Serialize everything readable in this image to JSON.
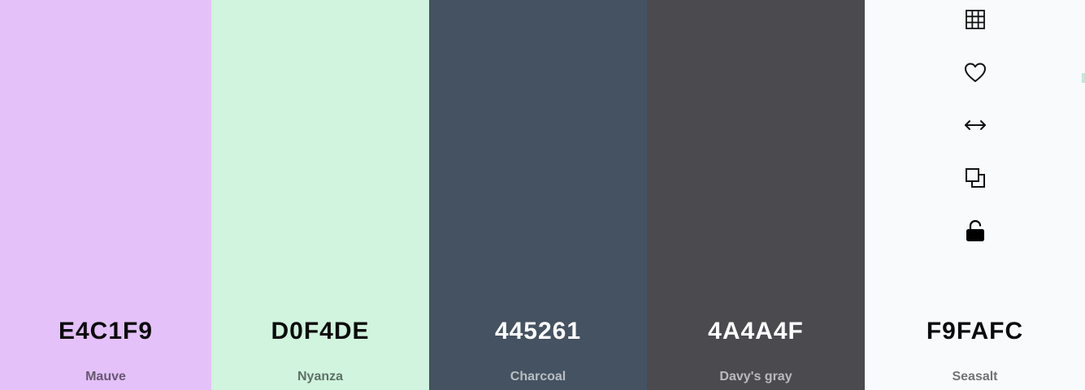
{
  "palette": {
    "swatches": [
      {
        "hex": "E4C1F9",
        "name": "Mauve",
        "color": "#E4C1F9"
      },
      {
        "hex": "D0F4DE",
        "name": "Nyanza",
        "color": "#D0F4DE"
      },
      {
        "hex": "445261",
        "name": "Charcoal",
        "color": "#445261"
      },
      {
        "hex": "4A4A4F",
        "name": "Davy's gray",
        "color": "#4A4A4F"
      },
      {
        "hex": "F9FAFC",
        "name": "Seasalt",
        "color": "#F9FAFC"
      }
    ],
    "tools": [
      {
        "icon": "grid-icon"
      },
      {
        "icon": "heart-icon"
      },
      {
        "icon": "arrows-horizontal-icon"
      },
      {
        "icon": "copy-icon"
      },
      {
        "icon": "unlock-icon"
      }
    ]
  }
}
